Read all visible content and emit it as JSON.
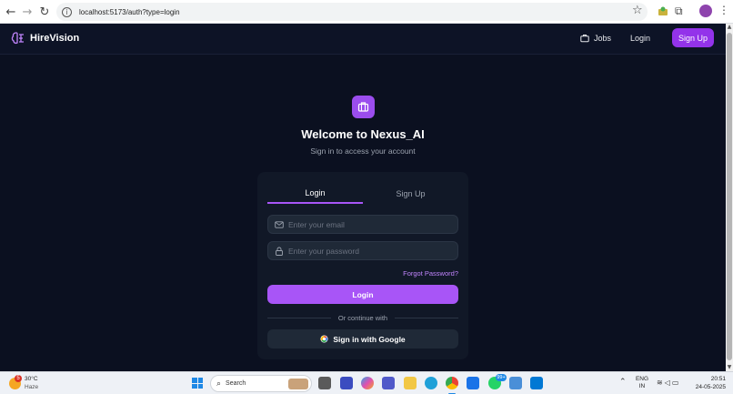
{
  "browser": {
    "url": "localhost:5173/auth?type=login"
  },
  "navbar": {
    "brand": "HireVision",
    "jobs_label": "Jobs",
    "login_label": "Login",
    "signup_label": "Sign Up"
  },
  "auth": {
    "title": "Welcome to Nexus_AI",
    "subtitle": "Sign in to access your account",
    "tabs": [
      {
        "label": "Login",
        "active": true
      },
      {
        "label": "Sign Up",
        "active": false
      }
    ],
    "email_placeholder": "Enter your email",
    "password_placeholder": "Enter your password",
    "forgot_password": "Forgot Password?",
    "login_button": "Login",
    "divider_text": "Or continue with",
    "google_button": "Sign in with Google"
  },
  "colors": {
    "accent": "#a855f7",
    "background": "#0b1020",
    "card": "#111827"
  },
  "taskbar": {
    "weather_badge": "5",
    "weather_temp": "30°C",
    "weather_condition": "Haze",
    "search_label": "Search",
    "whatsapp_badge": "99+",
    "language_line1": "ENG",
    "language_line2": "IN",
    "time": "20:51",
    "date": "24-05-2025"
  }
}
